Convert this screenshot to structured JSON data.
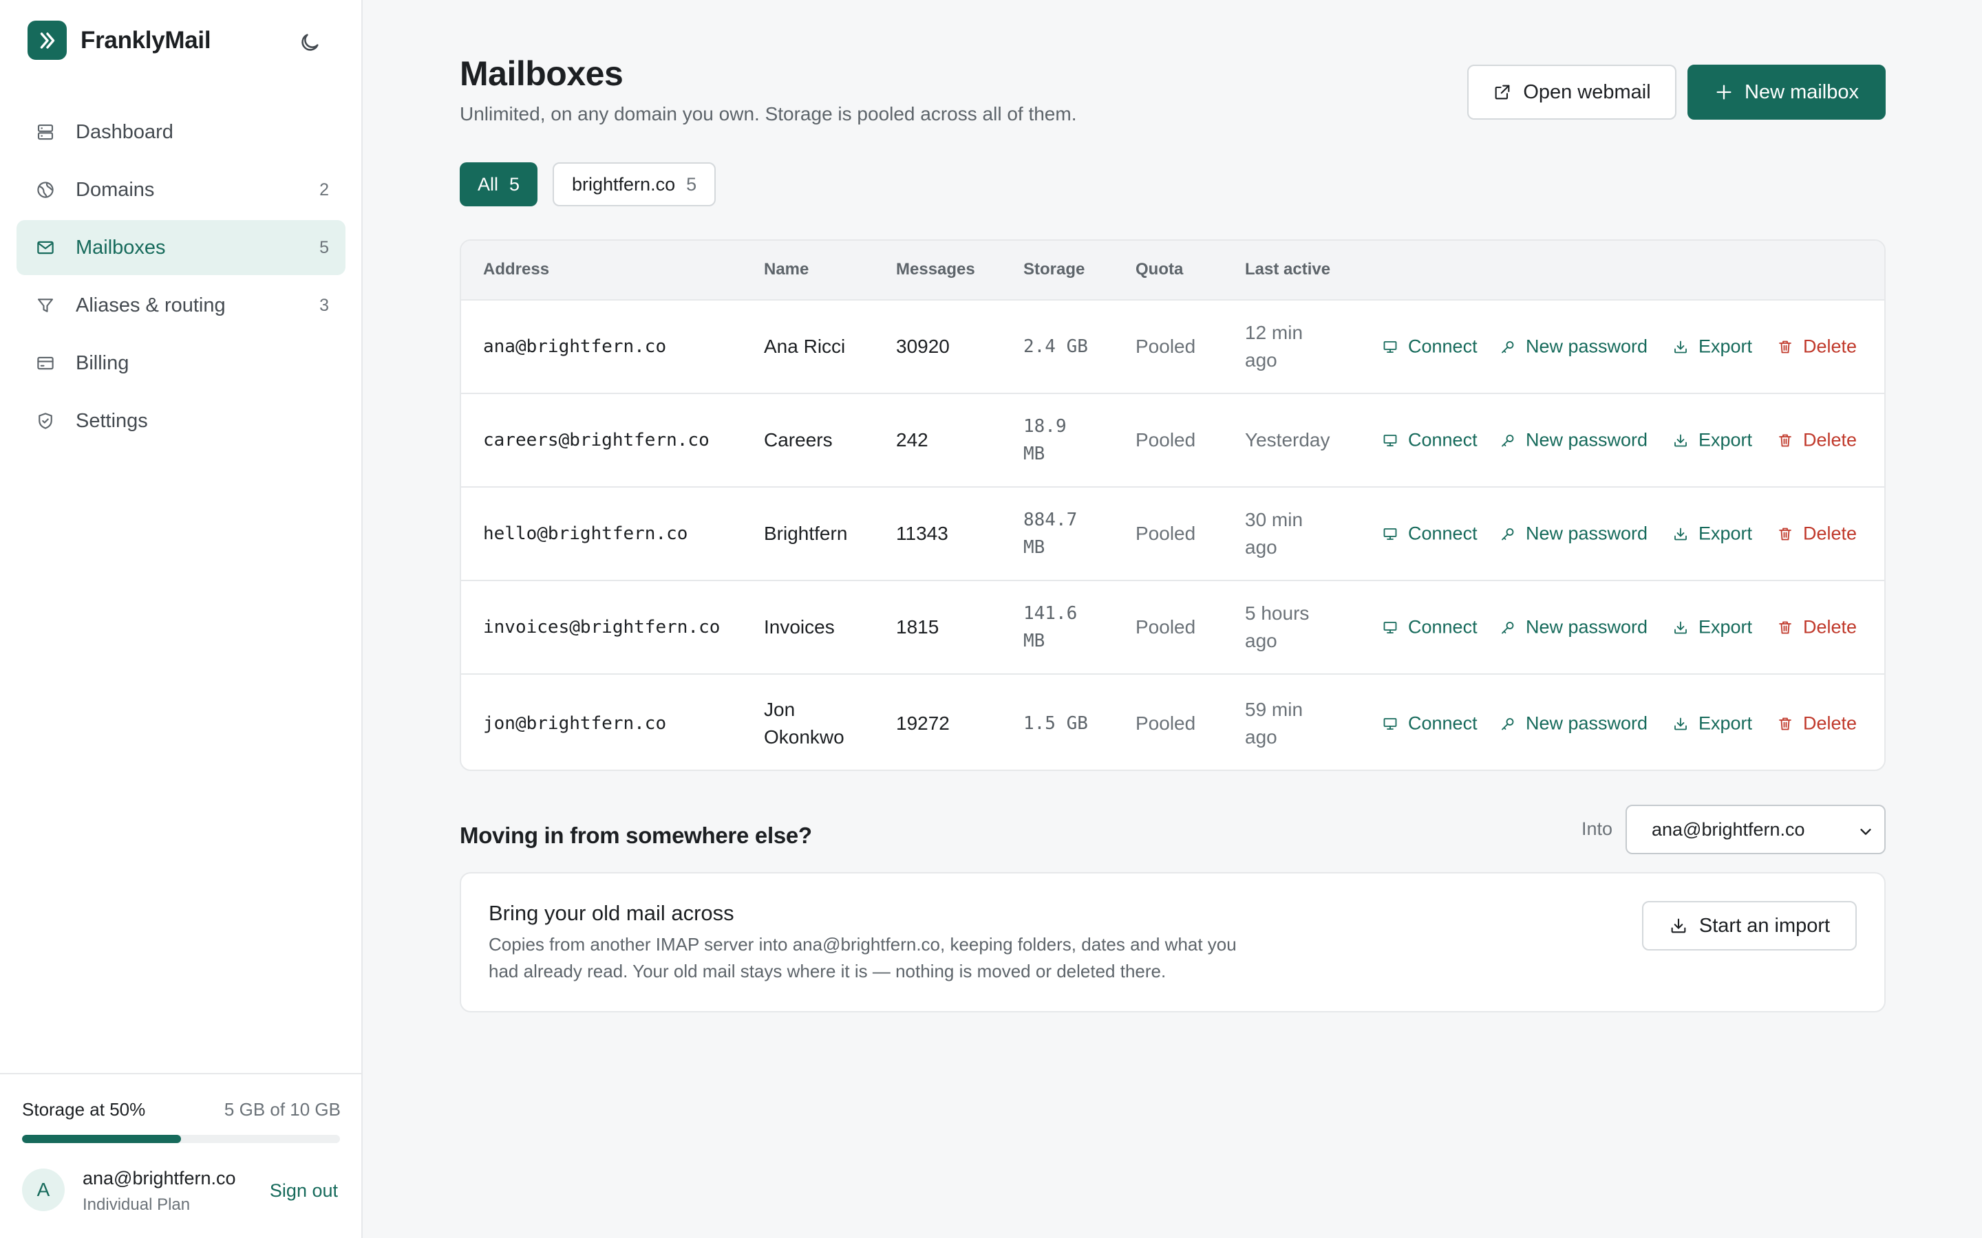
{
  "brand": {
    "name": "FranklyMail"
  },
  "colors": {
    "accent": "#166a5b",
    "accent_soft": "#e5f2ef",
    "danger": "#c0392b"
  },
  "nav": [
    {
      "label": "Dashboard",
      "count": "",
      "icon": "server-icon",
      "active": false
    },
    {
      "label": "Domains",
      "count": "2",
      "icon": "globe-icon",
      "active": false
    },
    {
      "label": "Mailboxes",
      "count": "5",
      "icon": "mail-icon",
      "active": true
    },
    {
      "label": "Aliases & routing",
      "count": "3",
      "icon": "filter-icon",
      "active": false
    },
    {
      "label": "Billing",
      "count": "",
      "icon": "credit-card-icon",
      "active": false
    },
    {
      "label": "Settings",
      "count": "",
      "icon": "shield-check-icon",
      "active": false
    }
  ],
  "storage": {
    "label": "Storage at 50%",
    "amount": "5 GB of 10 GB",
    "fraction": 0.5
  },
  "user": {
    "initial": "A",
    "email": "ana@brightfern.co",
    "plan": "Individual Plan",
    "signout": "Sign out"
  },
  "page": {
    "title": "Mailboxes",
    "subtitle": "Unlimited, on any domain you own. Storage is pooled across all of them.",
    "open_webmail": "Open webmail",
    "new_mailbox": "New mailbox"
  },
  "filters": [
    {
      "label": "All",
      "count": "5",
      "active": true
    },
    {
      "label": "brightfern.co",
      "count": "5",
      "active": false
    }
  ],
  "table": {
    "headers": {
      "address": "Address",
      "name": "Name",
      "messages": "Messages",
      "storage": "Storage",
      "quota": "Quota",
      "last_active": "Last active"
    },
    "actions": {
      "connect": "Connect",
      "new_password": "New password",
      "export": "Export",
      "delete": "Delete"
    },
    "rows": [
      {
        "address": "ana@brightfern.co",
        "name": "Ana Ricci",
        "messages": "30920",
        "storage": "2.4 GB",
        "quota": "Pooled",
        "last_active": "12 min ago"
      },
      {
        "address": "careers@brightfern.co",
        "name": "Careers",
        "messages": "242",
        "storage": "18.9 MB",
        "quota": "Pooled",
        "last_active": "Yesterday"
      },
      {
        "address": "hello@brightfern.co",
        "name": "Brightfern",
        "messages": "11343",
        "storage": "884.7 MB",
        "quota": "Pooled",
        "last_active": "30 min ago"
      },
      {
        "address": "invoices@brightfern.co",
        "name": "Invoices",
        "messages": "1815",
        "storage": "141.6 MB",
        "quota": "Pooled",
        "last_active": "5 hours ago"
      },
      {
        "address": "jon@brightfern.co",
        "name": "Jon Okonkwo",
        "messages": "19272",
        "storage": "1.5 GB",
        "quota": "Pooled",
        "last_active": "59 min ago"
      }
    ]
  },
  "import": {
    "heading": "Moving in from somewhere else?",
    "into_label": "Into",
    "into_value": "ana@brightfern.co",
    "card_title": "Bring your old mail across",
    "card_desc": "Copies from another IMAP server into ana@brightfern.co, keeping folders, dates and what you had already read. Your old mail stays where it is — nothing is moved or deleted there.",
    "button": "Start an import"
  }
}
